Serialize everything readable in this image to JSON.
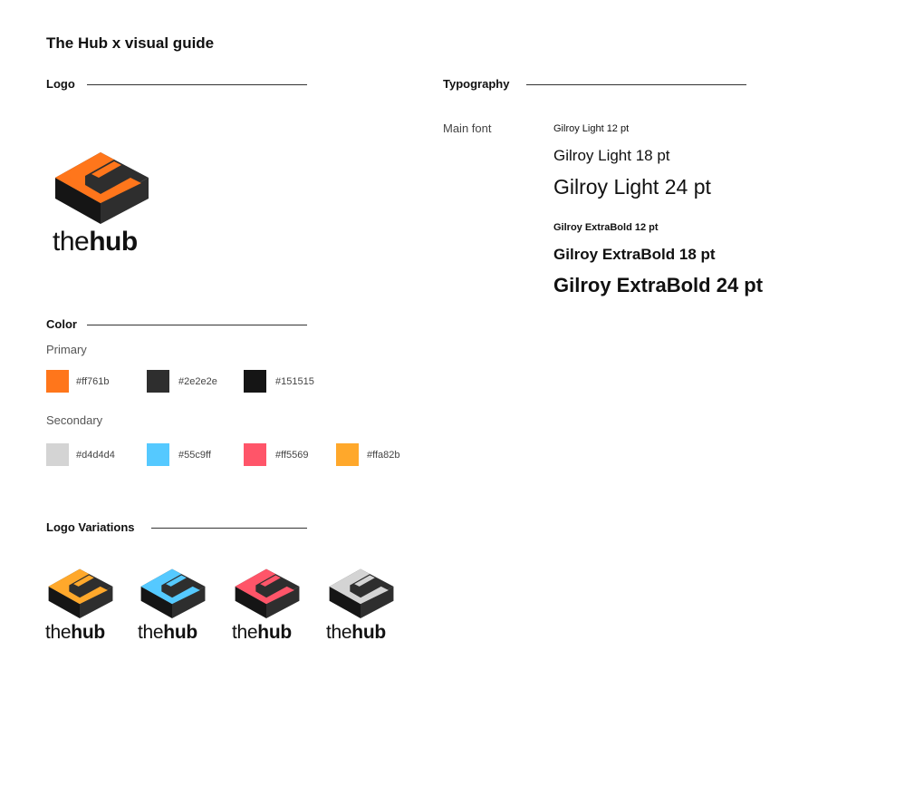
{
  "title": "The Hub x visual guide",
  "logo_section": {
    "heading": "Logo",
    "wordmark_light": "the",
    "wordmark_bold": "hub",
    "icon": "hub-cube-icon",
    "accent": "#ff761b"
  },
  "color_section": {
    "heading": "Color",
    "primary_label": "Primary",
    "primary": [
      {
        "hex": "#ff761b",
        "color": "#ff761b"
      },
      {
        "hex": "#2e2e2e",
        "color": "#2e2e2e"
      },
      {
        "hex": "#151515",
        "color": "#151515"
      }
    ],
    "secondary_label": "Secondary",
    "secondary": [
      {
        "hex": "#d4d4d4",
        "color": "#d4d4d4"
      },
      {
        "hex": "#55c9ff",
        "color": "#55c9ff"
      },
      {
        "hex": "#ff5569",
        "color": "#ff5569"
      },
      {
        "hex": "#ffa82b",
        "color": "#ffa82b"
      }
    ]
  },
  "variations_section": {
    "heading": "Logo Variations",
    "items": [
      {
        "accent": "#ffa82b",
        "wordmark_light": "the",
        "wordmark_bold": "hub"
      },
      {
        "accent": "#55c9ff",
        "wordmark_light": "the",
        "wordmark_bold": "hub"
      },
      {
        "accent": "#ff5569",
        "wordmark_light": "the",
        "wordmark_bold": "hub"
      },
      {
        "accent": "#d4d4d4",
        "wordmark_light": "the",
        "wordmark_bold": "hub"
      }
    ]
  },
  "typography_section": {
    "heading": "Typography",
    "font_label": "Main font",
    "samples": [
      {
        "text": "Gilroy Light 12 pt",
        "weight": "light"
      },
      {
        "text": "Gilroy Light 18 pt",
        "weight": "light"
      },
      {
        "text": "Gilroy Light 24 pt",
        "weight": "light"
      },
      {
        "text": "Gilroy ExtraBold 12 pt",
        "weight": "bold"
      },
      {
        "text": "Gilroy ExtraBold 18 pt",
        "weight": "bold"
      },
      {
        "text": "Gilroy ExtraBold 24 pt",
        "weight": "bold"
      }
    ]
  }
}
